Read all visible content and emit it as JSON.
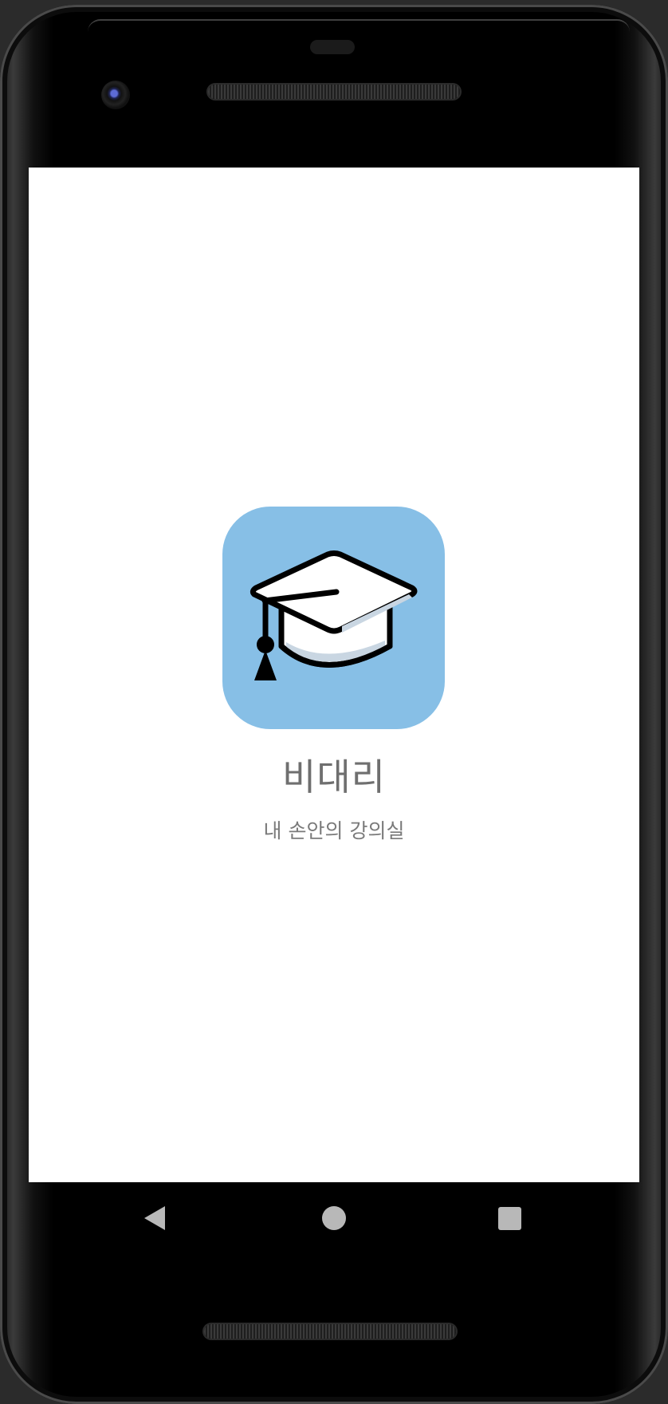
{
  "app": {
    "title": "비대리",
    "subtitle": "내 손안의 강의실",
    "icon": "graduation-cap-icon",
    "icon_background": "#87bfe6"
  },
  "navigation": {
    "back_icon": "back-triangle-icon",
    "home_icon": "home-circle-icon",
    "recents_icon": "recents-square-icon",
    "icon_color": "#b8b8b8"
  },
  "colors": {
    "screen_background": "#ffffff",
    "title_color": "#6f6f6f",
    "subtitle_color": "#7a7a7a"
  }
}
